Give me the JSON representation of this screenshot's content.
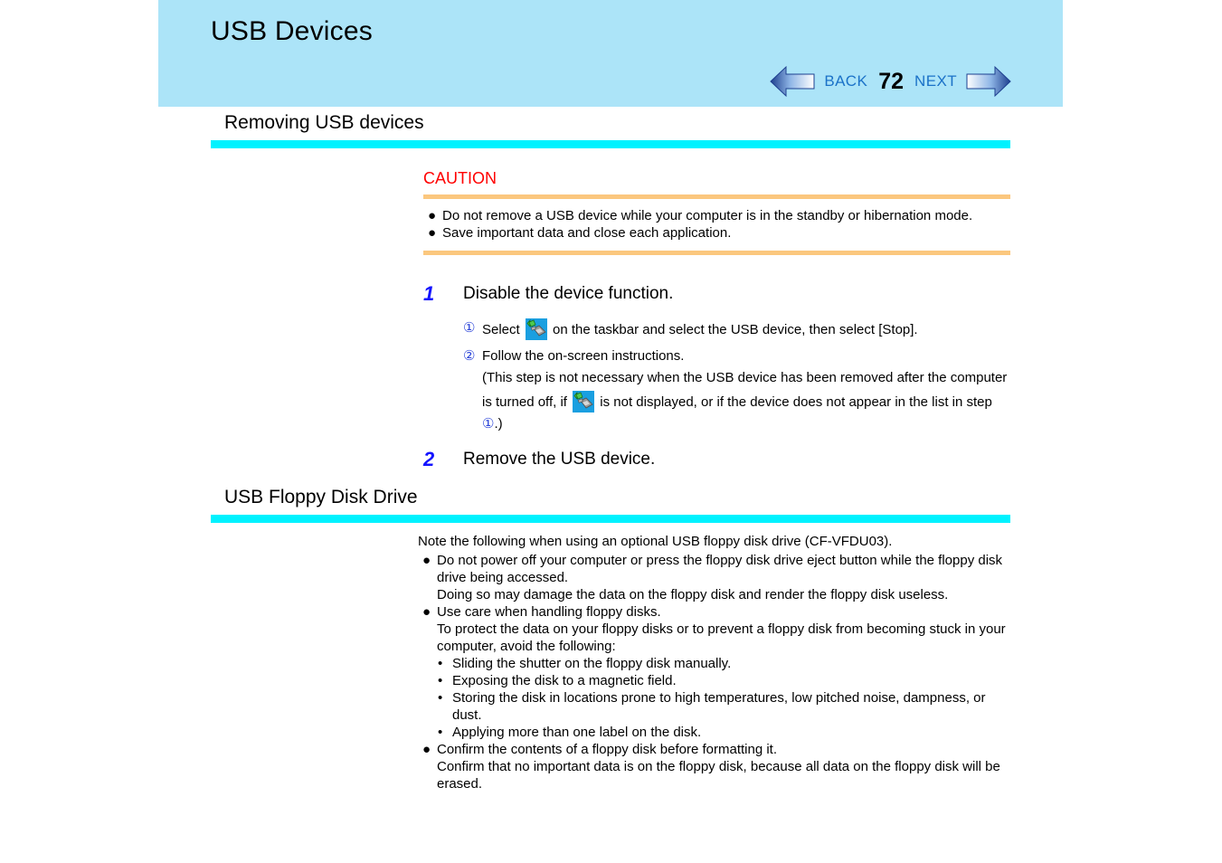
{
  "header": {
    "title": "USB Devices",
    "bg_color": "#ace4f8"
  },
  "nav": {
    "back_label": "BACK",
    "page_number": "72",
    "next_label": "NEXT",
    "back_arrow_icon": "arrow-left-icon",
    "next_arrow_icon": "arrow-right-icon",
    "link_color": "#1b72c8"
  },
  "sections": [
    {
      "title": "Removing USB devices",
      "rule_color": "#00f2ff"
    },
    {
      "title": "USB Floppy Disk Drive",
      "rule_color": "#00f2ff"
    }
  ],
  "caution": {
    "title": "CAUTION",
    "title_color": "#ff0000",
    "rule_color": "#fbc77e",
    "bullet_glyph": "●",
    "items": [
      "Do not remove a USB device while your computer is in the standby or hibernation mode.",
      "Save important data and close each application."
    ]
  },
  "steps": [
    {
      "number": "1",
      "text": "Disable the device function.",
      "substeps": [
        {
          "marker": "①",
          "parts": [
            {
              "type": "text",
              "value": "Select "
            },
            {
              "type": "icon",
              "value": "safely-remove-hardware-icon"
            },
            {
              "type": "text",
              "value": " on the taskbar and select the USB device, then select [Stop]."
            }
          ]
        },
        {
          "marker": "②",
          "parts": [
            {
              "type": "text",
              "value": "Follow the on-screen instructions."
            },
            {
              "type": "break",
              "value": ""
            },
            {
              "type": "text",
              "value": "(This step is not necessary when the USB device has been removed after the computer is turned off, if "
            },
            {
              "type": "icon",
              "value": "safely-remove-hardware-icon"
            },
            {
              "type": "text",
              "value": " is not displayed, or if the device does not appear in the list in step "
            },
            {
              "type": "circled",
              "value": "①"
            },
            {
              "type": "text",
              "value": ".)"
            }
          ]
        }
      ]
    },
    {
      "number": "2",
      "text": "Remove the USB device.",
      "substeps": []
    }
  ],
  "floppy": {
    "intro": "Note the following when using an optional USB floppy disk drive (CF-VFDU03).",
    "bullet_glyph": "●",
    "sub_bullet_glyph": "•",
    "items": [
      {
        "main": "Do not power off your computer or press the floppy disk drive eject button while the floppy disk drive being accessed.",
        "followups": [
          "Doing so may damage the data on the floppy disk and render the floppy disk useless."
        ],
        "sub_items": []
      },
      {
        "main": "Use care when handling floppy disks.",
        "followups": [
          "To protect the data on your floppy disks or to prevent a floppy disk from becoming stuck in your computer, avoid the following:"
        ],
        "sub_items": [
          "Sliding the shutter on the floppy disk manually.",
          "Exposing the disk to a magnetic field.",
          "Storing the disk in locations prone to high temperatures, low pitched noise, dampness, or dust.",
          "Applying more than one label on the disk."
        ]
      },
      {
        "main": "Confirm the contents of a floppy disk before formatting it.",
        "followups": [
          "Confirm that no important data is on the floppy disk, because all data on the floppy disk will be erased."
        ],
        "sub_items": []
      }
    ]
  }
}
